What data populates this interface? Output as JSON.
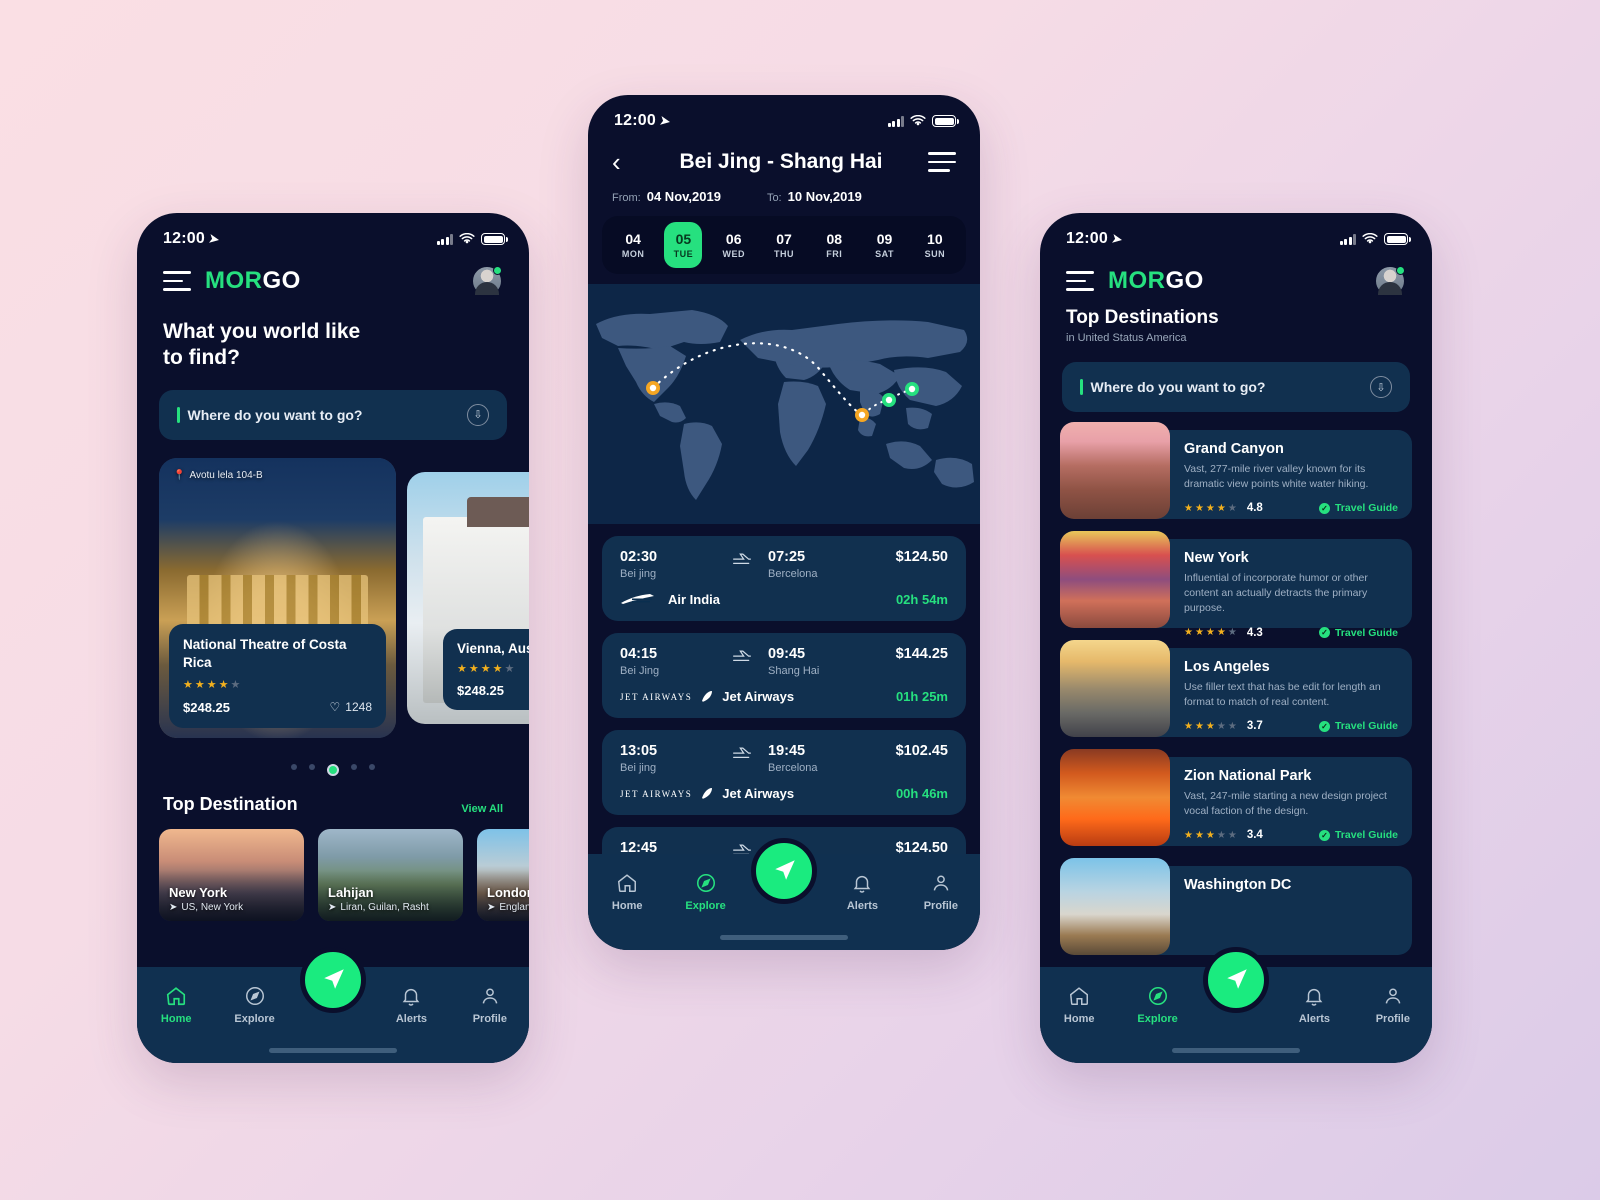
{
  "app": {
    "brand_prefix": "MOR",
    "brand_suffix": "GO"
  },
  "status_bar": {
    "time": "12:00",
    "location_icon": "navigation-arrow-icon"
  },
  "phone1": {
    "headline_line1": "What you world like",
    "headline_line2": "to find?",
    "search": {
      "placeholder": "Where do you want to go?",
      "mic_icon": "mic-download-icon"
    },
    "carousel": {
      "featured": {
        "address": "Avotu lela 104-B",
        "title": "National Theatre of Costa Rica",
        "rating_filled": 4,
        "rating_total": 5,
        "price": "$248.25",
        "likes": "1248"
      },
      "next": {
        "title": "Vienna, Austria",
        "rating_filled": 4,
        "rating_total": 5,
        "price": "$248.25"
      },
      "dot_count": 5,
      "active_dot": 2
    },
    "section": {
      "title": "Top Destination",
      "view_all": "View All"
    },
    "destinations": [
      {
        "name": "New York",
        "sub": "US, New York"
      },
      {
        "name": "Lahijan",
        "sub": "Liran, Guilan, Rasht"
      },
      {
        "name": "London",
        "sub": "England, Lo"
      }
    ],
    "tabs": [
      {
        "label": "Home",
        "icon": "home-icon",
        "active": true
      },
      {
        "label": "Explore",
        "icon": "compass-icon",
        "active": false
      },
      {
        "label": "Alerts",
        "icon": "bell-icon",
        "active": false
      },
      {
        "label": "Profile",
        "icon": "person-icon",
        "active": false
      }
    ]
  },
  "phone2": {
    "title": "Bei Jing - Shang Hai",
    "back_icon": "chevron-left-icon",
    "menu_icon": "hamburger-icon",
    "date_range": {
      "from_label": "From:",
      "from_value": "04 Nov,2019",
      "to_label": "To:",
      "to_value": "10 Nov,2019"
    },
    "days": [
      {
        "day": "04",
        "weekday": "MON",
        "selected": false
      },
      {
        "day": "05",
        "weekday": "TUE",
        "selected": true
      },
      {
        "day": "06",
        "weekday": "WED",
        "selected": false
      },
      {
        "day": "07",
        "weekday": "THU",
        "selected": false
      },
      {
        "day": "08",
        "weekday": "FRI",
        "selected": false
      },
      {
        "day": "09",
        "weekday": "SAT",
        "selected": false
      },
      {
        "day": "10",
        "weekday": "SUN",
        "selected": false
      }
    ],
    "flights": [
      {
        "depart_time": "02:30",
        "depart_city": "Bei jing",
        "arrive_time": "07:25",
        "arrive_city": "Bercelona",
        "price": "$124.50",
        "airline": "Air India",
        "airline_logo": "air-india-logo",
        "duration": "02h 54m"
      },
      {
        "depart_time": "04:15",
        "depart_city": "Bei Jing",
        "arrive_time": "09:45",
        "arrive_city": "Shang Hai",
        "price": "$144.25",
        "airline": "Jet Airways",
        "airline_logo": "jet-airways-logo",
        "airline_wordmark": "JET AIRWAYS",
        "duration": "01h 25m"
      },
      {
        "depart_time": "13:05",
        "depart_city": "Bei jing",
        "arrive_time": "19:45",
        "arrive_city": "Bercelona",
        "price": "$102.45",
        "airline": "Jet Airways",
        "airline_logo": "jet-airways-logo",
        "airline_wordmark": "JET AIRWAYS",
        "duration": "00h 46m"
      },
      {
        "depart_time": "12:45",
        "depart_city": "",
        "arrive_time": "",
        "arrive_city": "",
        "price": "$124.50",
        "airline": "",
        "duration": ""
      }
    ],
    "tabs": [
      {
        "label": "Home",
        "icon": "home-icon",
        "active": false
      },
      {
        "label": "Explore",
        "icon": "compass-icon",
        "active": true
      },
      {
        "label": "Alerts",
        "icon": "bell-icon",
        "active": false
      },
      {
        "label": "Profile",
        "icon": "person-icon",
        "active": false
      }
    ]
  },
  "phone3": {
    "title": "Top Destinations",
    "subtitle": "in United Status America",
    "search": {
      "placeholder": "Where do you want to go?",
      "mic_icon": "mic-download-icon"
    },
    "guide_label": "Travel Guide",
    "destinations": [
      {
        "name": "Grand Canyon",
        "desc": "Vast, 277-mile river valley known for its dramatic view points white water hiking.",
        "rating_filled": 4,
        "score": "4.8",
        "thumb": "grand-canyon-photo"
      },
      {
        "name": "New York",
        "desc": "Influential of incorporate humor or other content an actually detracts the primary purpose.",
        "rating_filled": 4,
        "score": "4.3",
        "thumb": "new-york-photo"
      },
      {
        "name": "Los Angeles",
        "desc": "Use filler text that has be edit for length an format to match of real content.",
        "rating_filled": 3,
        "score": "3.7",
        "thumb": "los-angeles-photo"
      },
      {
        "name": "Zion National Park",
        "desc": "Vast, 247-mile starting a new design project vocal faction of the design.",
        "rating_filled": 3,
        "score": "3.4",
        "thumb": "zion-photo"
      },
      {
        "name": "Washington DC",
        "desc": "",
        "rating_filled": 0,
        "score": "",
        "thumb": "washington-dc-photo"
      }
    ],
    "tabs": [
      {
        "label": "Home",
        "icon": "home-icon",
        "active": false
      },
      {
        "label": "Explore",
        "icon": "compass-icon",
        "active": true
      },
      {
        "label": "Alerts",
        "icon": "bell-icon",
        "active": false
      },
      {
        "label": "Profile",
        "icon": "person-icon",
        "active": false
      }
    ]
  },
  "colors": {
    "accent_green": "#26e07f",
    "screen_bg": "#0a0f2c",
    "card_bg": "#11304f",
    "tabbar_bg": "#103050",
    "star_gold": "#f2b01e"
  }
}
